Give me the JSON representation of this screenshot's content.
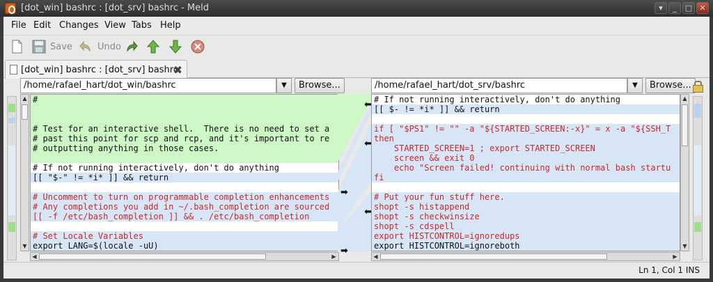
{
  "window": {
    "title": "[dot_win] bashrc : [dot_srv] bashrc - Meld",
    "buttons": [
      "▾",
      "_",
      "□",
      "✕"
    ]
  },
  "menu": [
    "File",
    "Edit",
    "Changes",
    "View",
    "Tabs",
    "Help"
  ],
  "toolbar": {
    "save_label": "Save",
    "undo_label": "Undo"
  },
  "tab": {
    "label": "[dot_win] bashrc : [dot_srv] bashrc"
  },
  "left": {
    "path": "/home/rafael_hart/dot_win/bashrc",
    "browse_label": "Browse..."
  },
  "right": {
    "path": "/home/rafael_hart/dot_srv/bashrc",
    "browse_label": "Browse..."
  },
  "left_lines": [
    {
      "text": "#",
      "bg": "green",
      "color": "dark"
    },
    {
      "text": "",
      "bg": "green",
      "color": "dark"
    },
    {
      "text": "",
      "bg": "green",
      "color": "dark"
    },
    {
      "text": "# Test for an interactive shell.  There is no need to set a",
      "bg": "green",
      "color": "dark"
    },
    {
      "text": "# past this point for scp and rcp, and it's important to re",
      "bg": "green",
      "color": "dark"
    },
    {
      "text": "# outputting anything in those cases.",
      "bg": "green",
      "color": "dark"
    },
    {
      "text": "",
      "bg": "green",
      "color": "dark"
    },
    {
      "text": "# If not running interactively, don't do anything",
      "bg": "",
      "color": "dark"
    },
    {
      "text": "[[ \"$-\" != *i* ]] && return",
      "bg": "blue",
      "color": "dark"
    },
    {
      "text": "",
      "bg": "",
      "color": "dark"
    },
    {
      "text": "# Uncomment to turn on programmable completion enhancements",
      "bg": "blue",
      "color": "red"
    },
    {
      "text": "# Any completions you add in ~/.bash_completion are sourced",
      "bg": "blue",
      "color": "red"
    },
    {
      "text": "[[ -f /etc/bash_completion ]] && . /etc/bash_completion",
      "bg": "blue",
      "color": "red"
    },
    {
      "text": "",
      "bg": "",
      "color": "dark"
    },
    {
      "text": "# Set Locale Variables",
      "bg": "blue",
      "color": "red"
    },
    {
      "text": "export LANG=$(locale -uU)",
      "bg": "blue",
      "color": "dark"
    }
  ],
  "right_lines": [
    {
      "text": "# If not running interactively, don't do anything",
      "bg": "",
      "color": "dark"
    },
    {
      "text": "[[ $- != *i* ]] && return",
      "bg": "blue",
      "color": "dark"
    },
    {
      "text": "",
      "bg": "",
      "color": "dark"
    },
    {
      "text": "if [ \"$PS1\" != \"\" -a \"${STARTED_SCREEN:-x}\" = x -a \"${SSH_T",
      "bg": "blue",
      "color": "red"
    },
    {
      "text": "then",
      "bg": "blue",
      "color": "red"
    },
    {
      "text": "    STARTED_SCREEN=1 ; export STARTED_SCREEN",
      "bg": "blue",
      "color": "red"
    },
    {
      "text": "    screen && exit 0",
      "bg": "blue",
      "color": "red"
    },
    {
      "text": "    echo \"Screen failed! continuing with normal bash startu",
      "bg": "blue",
      "color": "red"
    },
    {
      "text": "fi",
      "bg": "blue",
      "color": "red"
    },
    {
      "text": "",
      "bg": "",
      "color": "dark"
    },
    {
      "text": "# Put your fun stuff here.",
      "bg": "blue",
      "color": "red"
    },
    {
      "text": "shopt -s histappend",
      "bg": "blue",
      "color": "red"
    },
    {
      "text": "shopt -s checkwinsize",
      "bg": "blue",
      "color": "red"
    },
    {
      "text": "shopt -s cdspell",
      "bg": "blue",
      "color": "red"
    },
    {
      "text": "export HISTCONTROL=ignoredups",
      "bg": "blue",
      "color": "red"
    },
    {
      "text": "export HISTCONTROL=ignoreboth",
      "bg": "blue",
      "color": "dark"
    }
  ],
  "status": "Ln 1, Col 1 INS"
}
